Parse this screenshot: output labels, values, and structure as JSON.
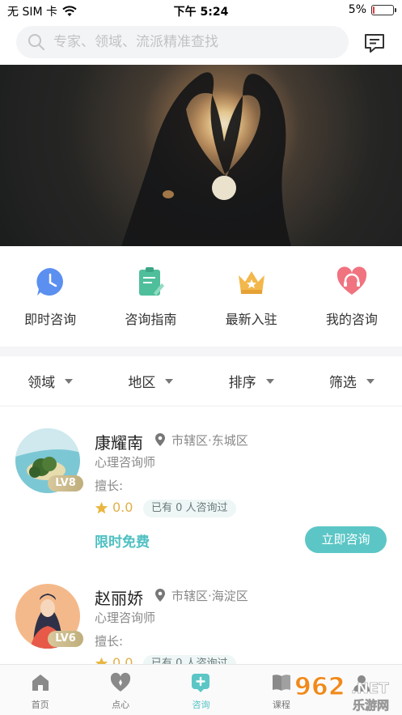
{
  "status_bar": {
    "carrier": "无 SIM 卡",
    "time": "下午 5:24",
    "battery": "5%",
    "battery_level": 0.05
  },
  "search": {
    "placeholder": "专家、领域、流派精准查找"
  },
  "quick_menu": [
    {
      "label": "即时咨询",
      "icon": "clock-icon"
    },
    {
      "label": "咨询指南",
      "icon": "guide-icon"
    },
    {
      "label": "最新入驻",
      "icon": "crown-icon"
    },
    {
      "label": "我的咨询",
      "icon": "heart-headset-icon"
    }
  ],
  "filters": [
    "领域",
    "地区",
    "排序",
    "筛选"
  ],
  "counselors": [
    {
      "name": "康耀南",
      "location": "市辖区·东城区",
      "role": "心理咨询师",
      "skill": "擅长:",
      "rating": "0.0",
      "consult_count": "已有 0 人咨询过",
      "level": "LV8",
      "price_tag": "限时免费",
      "cta": "立即咨询"
    },
    {
      "name": "赵丽娇",
      "location": "市辖区·海淀区",
      "role": "心理咨询师",
      "skill": "擅长:",
      "rating": "0.0",
      "consult_count": "已有 0 人咨询过",
      "level": "LV6"
    }
  ],
  "tabs": [
    {
      "label": "首页",
      "icon": "home-icon",
      "active": false
    },
    {
      "label": "点心",
      "icon": "heart-icon",
      "active": false
    },
    {
      "label": "咨询",
      "icon": "consult-icon",
      "active": true
    },
    {
      "label": "课程",
      "icon": "book-icon",
      "active": false
    },
    {
      "label": "",
      "icon": "profile-icon",
      "active": false
    }
  ],
  "watermark": {
    "text": "962",
    "suffix": ".NET",
    "subtitle": "乐游网"
  },
  "colors": {
    "accent": "#5cc6c6",
    "star": "#e0b047",
    "badge": "#d8c89c"
  }
}
